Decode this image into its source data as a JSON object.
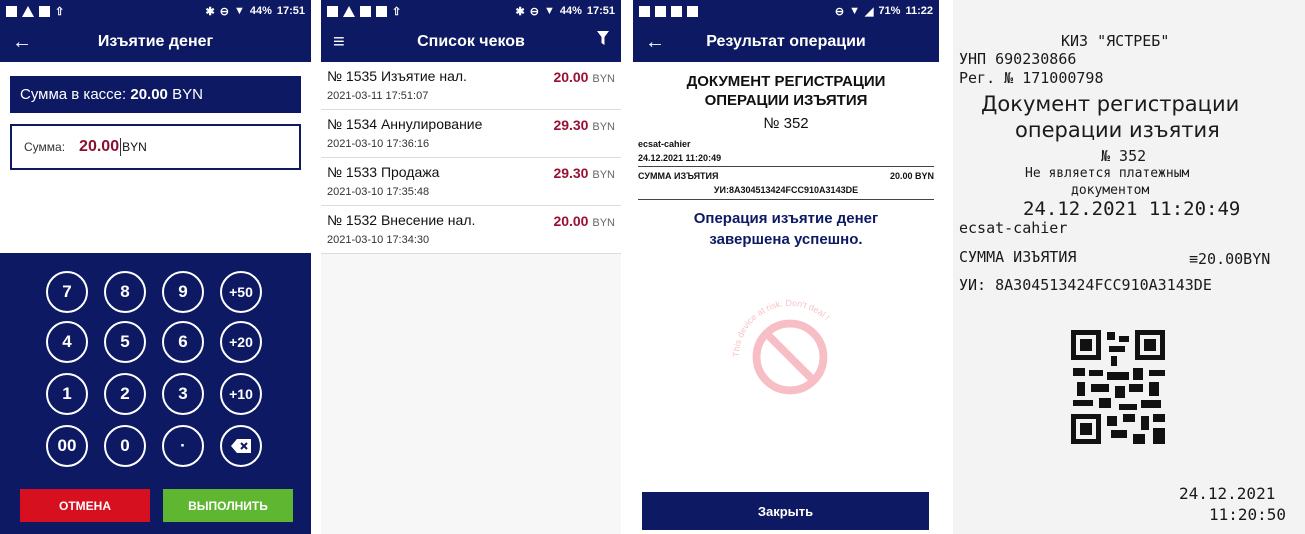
{
  "screen1": {
    "status": {
      "battery": "44%",
      "time": "17:51"
    },
    "title": "Изъятие денег",
    "cash_label": "Сумма в кассе:",
    "cash_value": "20.00",
    "cash_currency": "BYN",
    "amount_label": "Сумма:",
    "amount_value": "20.00",
    "amount_currency": "BYN",
    "keys": [
      "7",
      "8",
      "9",
      "+50",
      "4",
      "5",
      "6",
      "+20",
      "1",
      "2",
      "3",
      "+10",
      "00",
      "0",
      "·"
    ],
    "backspace_icon": "backspace-icon",
    "cancel_label": "ОТМЕНА",
    "execute_label": "ВЫПОЛНИТЬ",
    "colors": {
      "primary": "#0d1a63",
      "cancel": "#d7101f",
      "execute": "#5fb731",
      "amount": "#8a1030"
    }
  },
  "screen2": {
    "status": {
      "battery": "44%",
      "time": "17:51"
    },
    "title": "Список чеков",
    "receipts": [
      {
        "title": "№ 1535 Изъятие нал.",
        "date": "2021-03-11 17:51:07",
        "amount": "20.00",
        "currency": "BYN"
      },
      {
        "title": "№ 1534 Аннулирование",
        "date": "2021-03-10 17:36:16",
        "amount": "29.30",
        "currency": "BYN"
      },
      {
        "title": "№ 1533 Продажа",
        "date": "2021-03-10 17:35:48",
        "amount": "29.30",
        "currency": "BYN"
      },
      {
        "title": "№ 1532 Внесение нал.",
        "date": "2021-03-10 17:34:30",
        "amount": "20.00",
        "currency": "BYN"
      }
    ]
  },
  "screen3": {
    "status": {
      "battery": "71%",
      "time": "11:22"
    },
    "title": "Результат операции",
    "doc_title_line1": "ДОКУМЕНТ РЕГИСТРАЦИИ",
    "doc_title_line2": "ОПЕРАЦИИ ИЗЪЯТИЯ",
    "doc_number": "№ 352",
    "cashier": "ecsat-cahier",
    "datetime": "24.12.2021 11:20:49",
    "sum_label": "СУММА ИЗЪЯТИЯ",
    "sum_value": "20.00 BYN",
    "uid": "УИ:8A304513424FCC910A3143DE",
    "success_line1": "Операция изъятие денег",
    "success_line2": "завершена успешно.",
    "watermark_text": "This device at risk. Don't deal !",
    "close_label": "Закрыть"
  },
  "screen4": {
    "line_kiz": "КИЗ \"ЯСТРЕБ\"",
    "line_unp": "УНП 690230866",
    "line_reg": "Рег. № 171000798",
    "line_doc1": "Документ регистрации",
    "line_doc2": "операции изъятия",
    "line_num": "№ 352",
    "line_not1": "Не является платежным",
    "line_not2": "документом",
    "line_dt": "24.12.2021 11:20:49",
    "line_cashier": "ecsat-cahier",
    "line_sum_label": "СУММА ИЗЪЯТИЯ",
    "line_sum_value": "≡20.00BYN",
    "line_uid": "УИ: 8A304513424FCC910A3143DE",
    "footer_date": "24.12.2021",
    "footer_time": "11:20:50"
  }
}
